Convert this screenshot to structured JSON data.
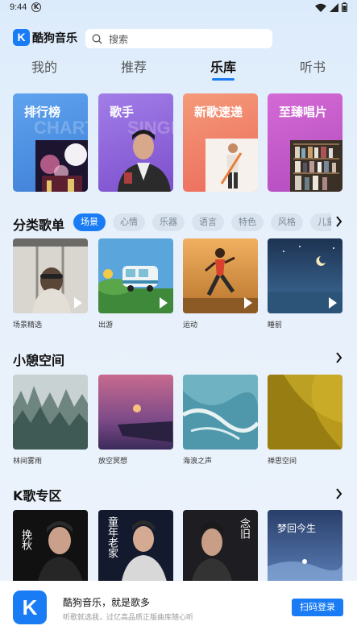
{
  "status_bar": {
    "time": "9:44",
    "k_badge": "K"
  },
  "header": {
    "logo_mark": "K",
    "logo_text": "酷狗音乐",
    "search_placeholder": "搜索"
  },
  "tabs": [
    {
      "label": "我的"
    },
    {
      "label": "推荐"
    },
    {
      "label": "乐库",
      "active": true
    },
    {
      "label": "听书"
    }
  ],
  "feature_cards": [
    {
      "title": "排行榜",
      "bg_word": "CHART",
      "color": "#4f90e0"
    },
    {
      "title": "歌手",
      "bg_word": "SINGER",
      "color": "#8e63d8"
    },
    {
      "title": "新歌速递",
      "bg_word": "",
      "color": "#f07a63"
    },
    {
      "title": "至臻唱片",
      "bg_word": "",
      "color": "#c254c2"
    }
  ],
  "category_section": {
    "title": "分类歌单",
    "chips": [
      {
        "label": "场景",
        "active": true
      },
      {
        "label": "心情"
      },
      {
        "label": "乐器"
      },
      {
        "label": "语言"
      },
      {
        "label": "特色"
      },
      {
        "label": "风格"
      },
      {
        "label": "儿童"
      }
    ],
    "playlists": [
      {
        "label": "场景精选"
      },
      {
        "label": "出游"
      },
      {
        "label": "运动"
      },
      {
        "label": "睡前"
      }
    ]
  },
  "relax_section": {
    "title": "小憩空间",
    "playlists": [
      {
        "label": "林间雾雨"
      },
      {
        "label": "放空冥想"
      },
      {
        "label": "海浪之声"
      },
      {
        "label": "禅思空间"
      }
    ]
  },
  "ktv_section": {
    "title": "K歌专区",
    "cover_texts": [
      "挽秋",
      "童年老家",
      "念旧",
      "梦回今生"
    ]
  },
  "bottom_banner": {
    "logo_mark": "K",
    "title": "酷狗音乐，就是歌多",
    "subtitle": "听歌就选我，过亿高品质正版曲库随心听",
    "button": "扫码登录"
  },
  "colors": {
    "accent": "#1a7cf5"
  }
}
